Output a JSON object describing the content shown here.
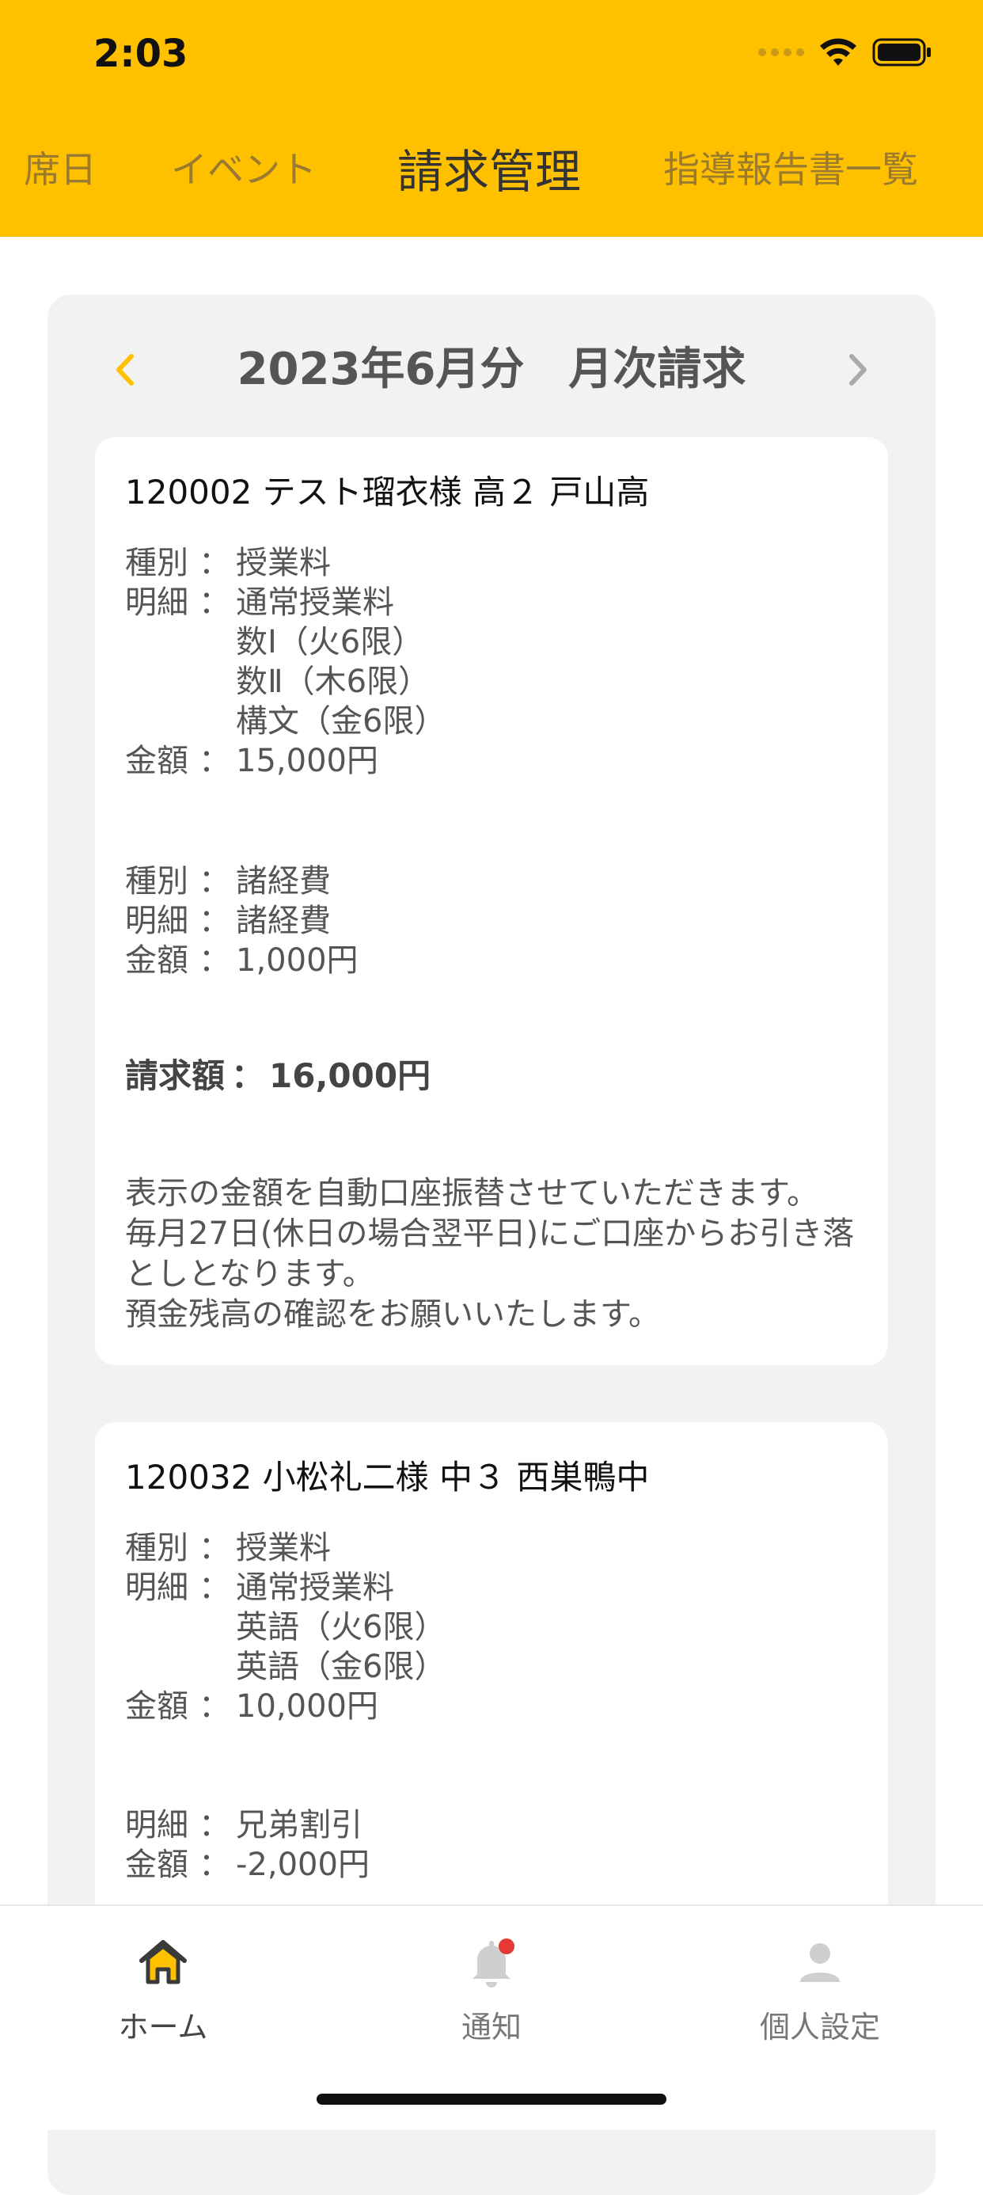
{
  "status": {
    "time": "2:03"
  },
  "tabs": [
    {
      "label": "席日"
    },
    {
      "label": "イベント"
    },
    {
      "label": "請求管理",
      "active": true
    },
    {
      "label": "指導報告書一覧"
    }
  ],
  "month": {
    "title": "2023年6月分　月次請求"
  },
  "cards": [
    {
      "title": "120002 テスト瑠衣様 高２ 戸山高",
      "sections": [
        {
          "type_label": "種別",
          "type_value": "授業料",
          "detail_label": "明細",
          "detail_value": "通常授業料",
          "detail_lines": [
            "数Ⅰ（火6限）",
            "数Ⅱ（木6限）",
            "構文（金6限）"
          ],
          "amount_label": "金額",
          "amount_value": "15,000円"
        },
        {
          "type_label": "種別",
          "type_value": "諸経費",
          "detail_label": "明細",
          "detail_value": "諸経費",
          "amount_label": "金額",
          "amount_value": "1,000円"
        }
      ],
      "total_label": "請求額",
      "total_value": "16,000円",
      "note_lines": [
        "表示の金額を自動口座振替させていただきます。",
        "毎月27日(休日の場合翌平日)にご口座からお引き落としとなります。",
        "預金残高の確認をお願いいたします。"
      ]
    },
    {
      "title": "120032 小松礼二様 中３ 西巣鴨中",
      "sections": [
        {
          "type_label": "種別",
          "type_value": "授業料",
          "detail_label": "明細",
          "detail_value": "通常授業料",
          "detail_lines": [
            "英語（火6限）",
            "英語（金6限）"
          ],
          "amount_label": "金額",
          "amount_value": "10,000円"
        },
        {
          "detail_label": "明細",
          "detail_value": "兄弟割引",
          "amount_label": "金額",
          "amount_value": "-2,000円"
        }
      ]
    }
  ],
  "bottom_nav": [
    {
      "label": "ホーム",
      "icon": "home-icon",
      "active": true
    },
    {
      "label": "通知",
      "icon": "bell-icon",
      "badge_color": "#E53935"
    },
    {
      "label": "個人設定",
      "icon": "person-icon"
    }
  ],
  "colors": {
    "accent": "#FFC000"
  }
}
